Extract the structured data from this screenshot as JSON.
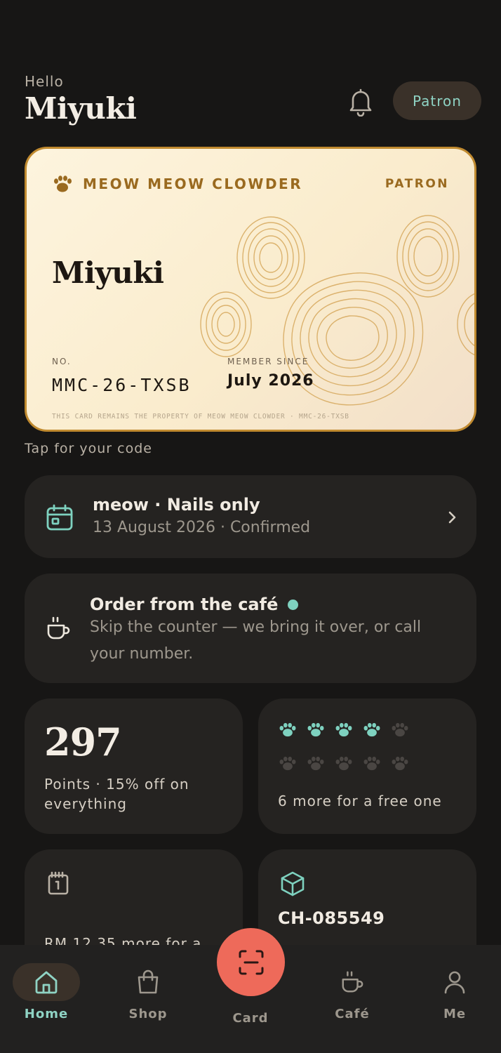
{
  "header": {
    "greeting": "Hello",
    "user_name": "Miyuki",
    "tier_pill": "Patron",
    "bell_icon": "bell-icon"
  },
  "card": {
    "brand": "MEOW MEOW CLOWDER",
    "tier": "PATRON",
    "holder": "Miyuki",
    "number_label": "NO.",
    "number": "MMC-26-TXSB",
    "since_label": "MEMBER SINCE",
    "since": "July 2026",
    "fine_print": "THIS CARD REMAINS THE PROPERTY OF MEOW MEOW CLOWDER · MMC-26-TXSB",
    "accent": "#c08a2f"
  },
  "tap_hint": "Tap for your code",
  "appointment": {
    "title": "meow · Nails only",
    "subtitle": "13 August 2026 · Confirmed",
    "icon": "calendar-icon"
  },
  "cafe_order": {
    "title": "Order from the café",
    "subtitle": "Skip the counter — we bring it over, or call your number.",
    "icon": "coffee-cup-icon",
    "status_color": "#7ed1bf"
  },
  "points": {
    "value": "297",
    "label": "Points · 15% off on everything"
  },
  "stamps": {
    "filled": 4,
    "total": 10,
    "label": "6 more for a free one",
    "filled_color": "#7ed1bf"
  },
  "reward_tile": {
    "label": "RM 12.35 more for a",
    "icon": "gift-box-icon"
  },
  "order_tile": {
    "label": "CH-085549",
    "icon": "package-icon"
  },
  "nav": {
    "items": [
      {
        "label": "Home",
        "icon": "home-icon",
        "active": true
      },
      {
        "label": "Shop",
        "icon": "shopping-bag-icon",
        "active": false
      },
      {
        "label": "Card",
        "icon": "scan-icon",
        "active": false
      },
      {
        "label": "Café",
        "icon": "coffee-cup-icon",
        "active": false
      },
      {
        "label": "Me",
        "icon": "user-icon",
        "active": false
      }
    ],
    "active_color": "#8fd3c4",
    "fab_color": "#ee6a5a"
  }
}
